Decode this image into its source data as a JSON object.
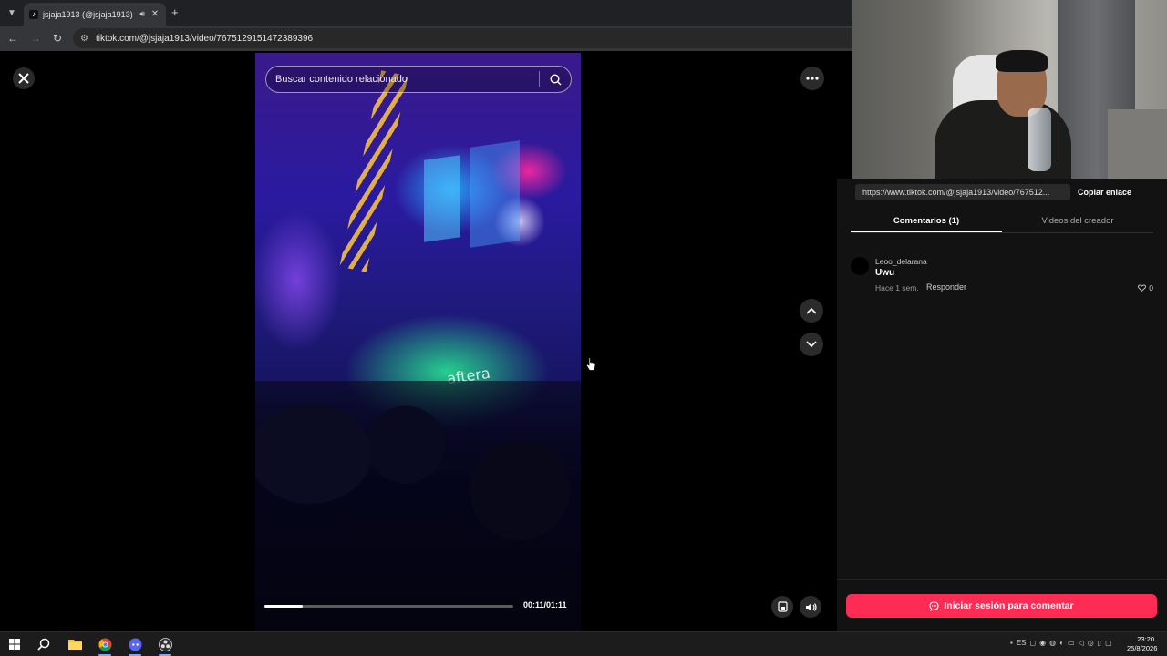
{
  "browser": {
    "tab_title": "jsjaja1913 (@jsjaja1913) | Ti",
    "url": "tiktok.com/@jsjaja1913/video/7675129151472389396"
  },
  "viewer": {
    "search_placeholder": "Buscar contenido relacionado",
    "time": "00:11/01:11",
    "progress_fraction": 0.155,
    "video_overlay_text": "aftera"
  },
  "side": {
    "share_url": "https://www.tiktok.com/@jsjaja1913/video/767512...",
    "copy_link": "Copiar enlace",
    "tabs": [
      "Comentarios (1)",
      "Videos del creador"
    ],
    "comment": {
      "user": "Leoo_delarana",
      "text": "Uwu",
      "time": "Hace 1 sem.",
      "reply": "Responder",
      "likes": "0"
    },
    "login_button": "Iniciar sesión para comentar"
  },
  "taskbar": {
    "time": "23:20",
    "date": "25/8/2026"
  },
  "colors": {
    "accent": "#fe2c55",
    "background": "#000000",
    "panel": "#121212"
  }
}
